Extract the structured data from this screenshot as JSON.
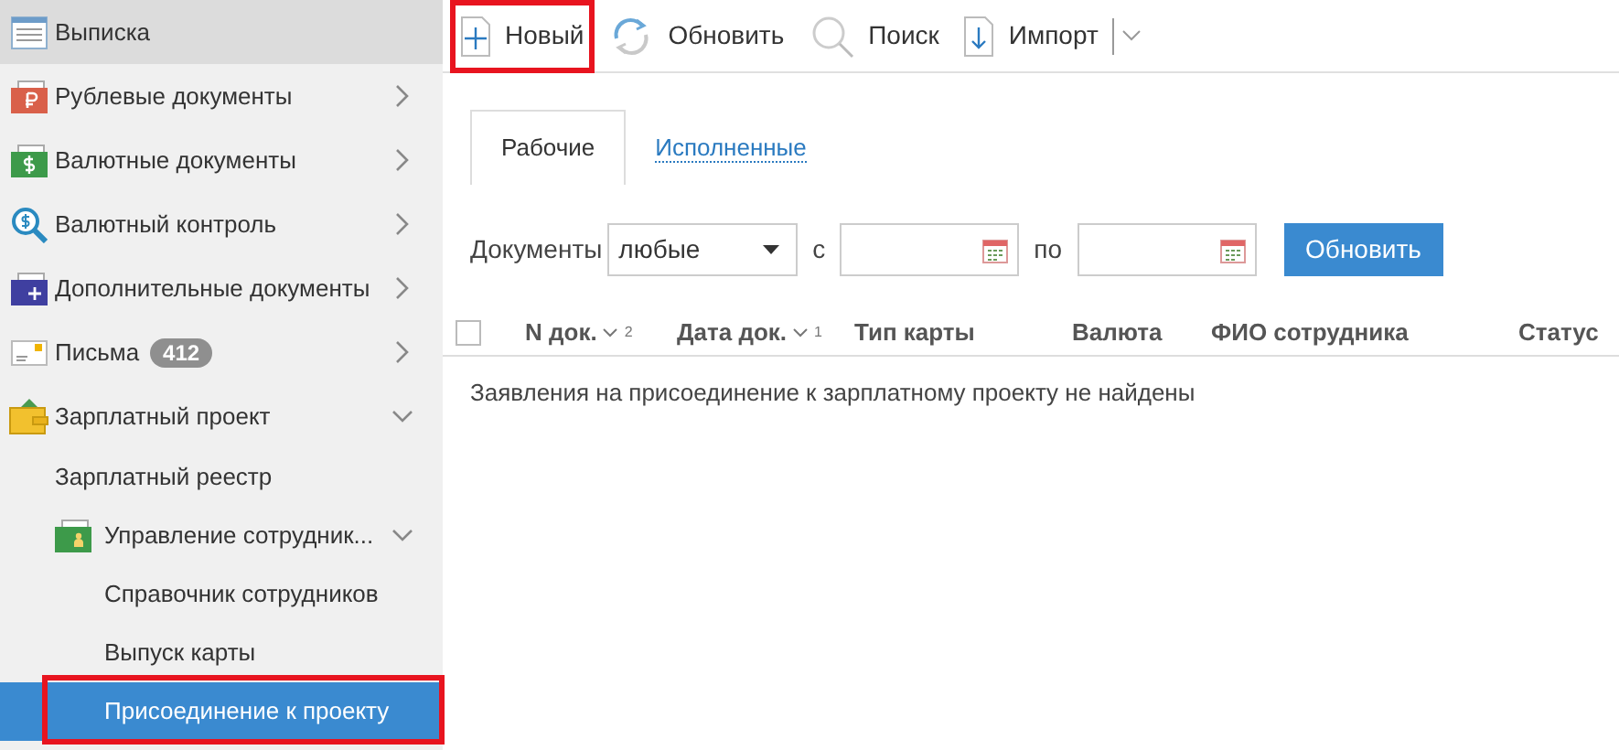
{
  "sidebar": {
    "items": [
      {
        "label": "Выписка",
        "selected": false,
        "hovered": true,
        "highlighted": false
      },
      {
        "label": "Рублевые документы",
        "expanded": false,
        "selected": false,
        "hovered": false,
        "highlighted": false
      },
      {
        "label": "Валютные документы",
        "expanded": false,
        "selected": false,
        "hovered": false,
        "highlighted": false
      },
      {
        "label": "Валютный контроль",
        "expanded": false,
        "selected": false,
        "hovered": false,
        "highlighted": false
      },
      {
        "label": "Дополнительные документы",
        "expanded": false,
        "selected": false,
        "hovered": false,
        "highlighted": false
      },
      {
        "label": "Письма",
        "badge": "412",
        "expanded": false,
        "selected": false,
        "hovered": false,
        "highlighted": false
      },
      {
        "label": "Зарплатный проект",
        "expanded": true,
        "selected": false,
        "hovered": false,
        "highlighted": false,
        "children": [
          {
            "label": "Зарплатный реестр",
            "selected": false,
            "hovered": false,
            "highlighted": false
          },
          {
            "label": "Управление сотрудник...",
            "expanded": true,
            "selected": false,
            "hovered": false,
            "highlighted": false,
            "children": [
              {
                "label": "Справочник сотрудников",
                "selected": false,
                "hovered": false,
                "highlighted": false
              },
              {
                "label": "Выпуск карты",
                "selected": false,
                "hovered": false,
                "highlighted": false
              },
              {
                "label": "Присоединение к проекту",
                "selected": true,
                "hovered": false,
                "highlighted": true
              }
            ]
          }
        ]
      }
    ]
  },
  "toolbar": {
    "buttons": [
      {
        "label": "Новый",
        "highlighted": true
      },
      {
        "label": "Обновить",
        "highlighted": false
      },
      {
        "label": "Поиск",
        "highlighted": false
      },
      {
        "label": "Импорт",
        "highlighted": false,
        "dropdown": true
      }
    ]
  },
  "tabs": [
    {
      "label": "Рабочие",
      "selected": true
    },
    {
      "label": "Исполненные",
      "selected": false
    }
  ],
  "filter": {
    "documents_label": "Документы",
    "documents_value": "любые",
    "from_label": "с",
    "to_label": "по",
    "button": "Обновить"
  },
  "table": {
    "columns": [
      {
        "label": "N док.",
        "sort": "2"
      },
      {
        "label": "Дата док.",
        "sort": "1"
      },
      {
        "label": "Тип карты"
      },
      {
        "label": "Валюта"
      },
      {
        "label": "ФИО сотрудника"
      },
      {
        "label": "Статус"
      }
    ],
    "checked": false,
    "empty_message": "Заявления на присоединение к зарплатному проекту не найдены"
  }
}
